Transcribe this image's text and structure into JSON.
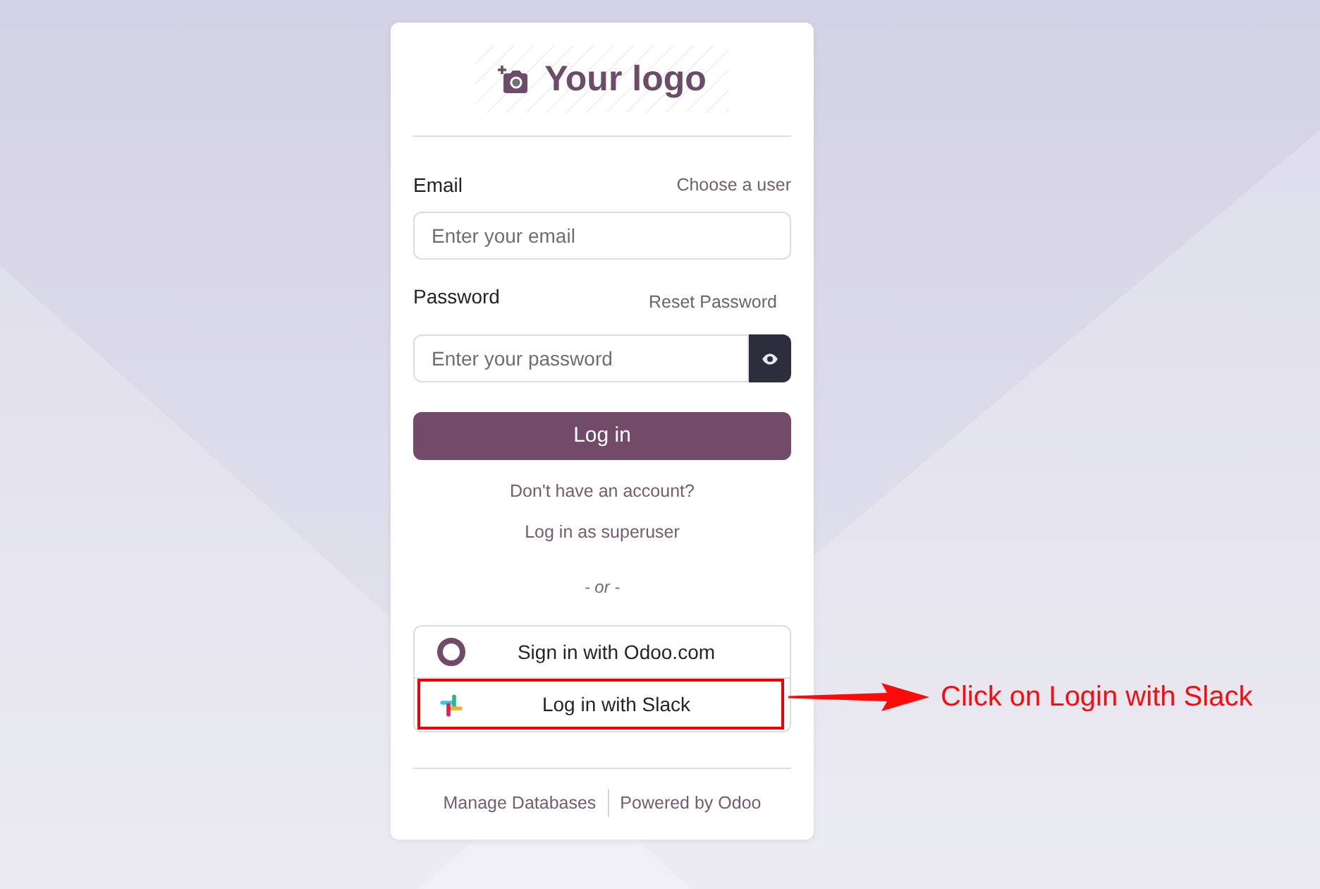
{
  "logo": {
    "text": "Your logo"
  },
  "fields": [
    {
      "kind": "text",
      "label": "Email",
      "link": "Choose a user",
      "placeholder": "Enter your email"
    },
    {
      "kind": "password",
      "label": "Password",
      "link": "Reset Password",
      "placeholder": "Enter your password"
    }
  ],
  "submit_button": "Log in",
  "links": [
    "Don't have an account?",
    "Log in as superuser"
  ],
  "separator": "- or -",
  "providers": [
    {
      "kind": "odoo",
      "label": "Sign in with Odoo.com",
      "highlighted": false
    },
    {
      "kind": "slack",
      "label": "Log in with Slack",
      "highlighted": true
    }
  ],
  "footer_links": [
    "Manage Databases",
    "Powered by Odoo"
  ],
  "callout": {
    "text": "Click on Login with Slack"
  }
}
